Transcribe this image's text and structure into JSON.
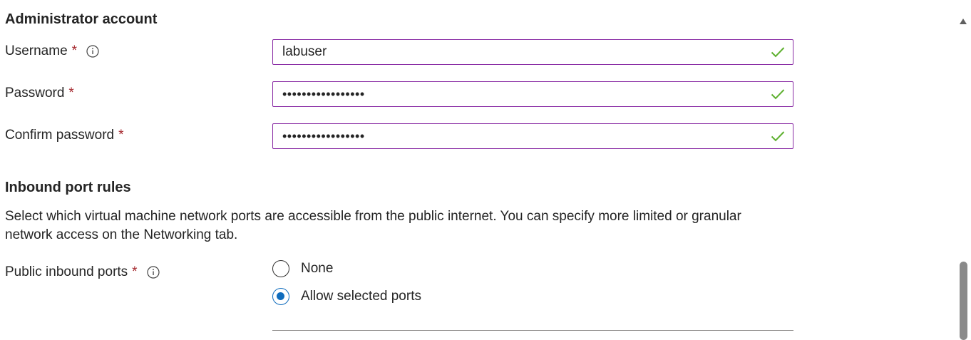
{
  "admin": {
    "section_title": "Administrator account",
    "username": {
      "label": "Username",
      "required_mark": "*",
      "value": "labuser",
      "info_icon": "info-icon",
      "status_icon": "checkmark-icon"
    },
    "password": {
      "label": "Password",
      "required_mark": "*",
      "value": "•••••••••••••••••",
      "status_icon": "checkmark-icon"
    },
    "confirm_password": {
      "label": "Confirm password",
      "required_mark": "*",
      "value": "•••••••••••••••••",
      "status_icon": "checkmark-icon"
    }
  },
  "inbound": {
    "section_title": "Inbound port rules",
    "description": "Select which virtual machine network ports are accessible from the public internet. You can specify more limited or granular network access on the Networking tab.",
    "public_ports": {
      "label": "Public inbound ports",
      "required_mark": "*",
      "info_icon": "info-icon",
      "options": [
        {
          "label": "None",
          "selected": false
        },
        {
          "label": "Allow selected ports",
          "selected": true
        }
      ]
    }
  },
  "colors": {
    "field_border": "#8a2da5",
    "valid_check": "#5db02e",
    "required": "#a4262c",
    "radio_selected": "#0f6cbd"
  }
}
